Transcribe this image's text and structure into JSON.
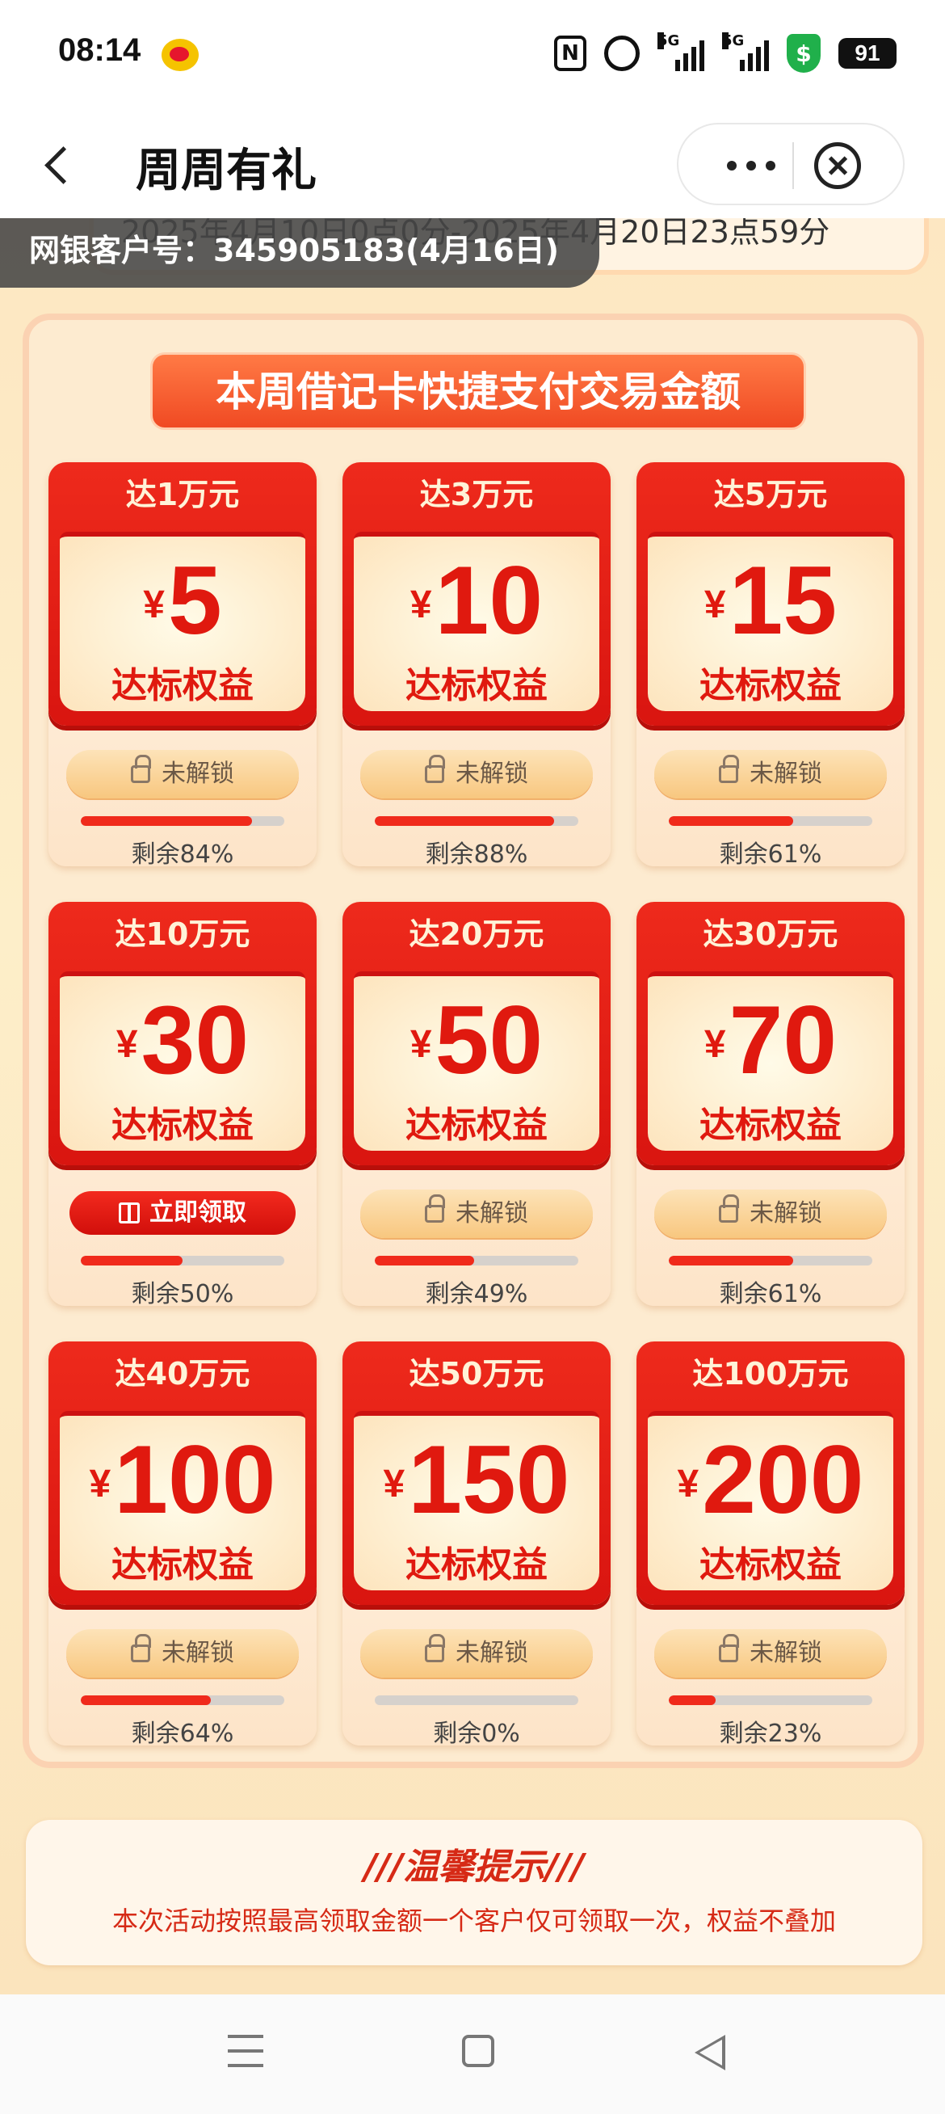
{
  "status_bar": {
    "time": "08:14",
    "battery": "91",
    "signal_1": "5G",
    "signal_2": "5G",
    "nfc": "N",
    "shield": "$"
  },
  "header": {
    "title": "周周有礼"
  },
  "banner": {
    "date_range_partial": "2025年4月10日0点0分-2025年4月20日23点59分",
    "customer": "网银客户号：345905183(4月16日)"
  },
  "section_title": "本周借记卡快捷支付交易金额",
  "currency_symbol": "¥",
  "cards": [
    {
      "threshold": "达1万元",
      "amount": "5",
      "sub": "达标权益",
      "button": "未解锁",
      "state": "locked",
      "remaining_pct": 84,
      "remaining_text": "剩余84%"
    },
    {
      "threshold": "达3万元",
      "amount": "10",
      "sub": "达标权益",
      "button": "未解锁",
      "state": "locked",
      "remaining_pct": 88,
      "remaining_text": "剩余88%"
    },
    {
      "threshold": "达5万元",
      "amount": "15",
      "sub": "达标权益",
      "button": "未解锁",
      "state": "locked",
      "remaining_pct": 61,
      "remaining_text": "剩余61%"
    },
    {
      "threshold": "达10万元",
      "amount": "30",
      "sub": "达标权益",
      "button": "立即领取",
      "state": "claim",
      "remaining_pct": 50,
      "remaining_text": "剩余50%"
    },
    {
      "threshold": "达20万元",
      "amount": "50",
      "sub": "达标权益",
      "button": "未解锁",
      "state": "locked",
      "remaining_pct": 49,
      "remaining_text": "剩余49%"
    },
    {
      "threshold": "达30万元",
      "amount": "70",
      "sub": "达标权益",
      "button": "未解锁",
      "state": "locked",
      "remaining_pct": 61,
      "remaining_text": "剩余61%"
    },
    {
      "threshold": "达40万元",
      "amount": "100",
      "sub": "达标权益",
      "button": "未解锁",
      "state": "locked",
      "remaining_pct": 64,
      "remaining_text": "剩余64%"
    },
    {
      "threshold": "达50万元",
      "amount": "150",
      "sub": "达标权益",
      "button": "未解锁",
      "state": "locked",
      "remaining_pct": 0,
      "remaining_text": "剩余0%"
    },
    {
      "threshold": "达100万元",
      "amount": "200",
      "sub": "达标权益",
      "button": "未解锁",
      "state": "locked",
      "remaining_pct": 23,
      "remaining_text": "剩余23%"
    }
  ],
  "tips": {
    "title": "///温馨提示///",
    "text": "本次活动按照最高领取金额一个客户仅可领取一次，权益不叠加"
  },
  "colors": {
    "accent_red": "#e0190f",
    "progress_red": "#f02a1b",
    "page_background": "#fde7c2"
  }
}
